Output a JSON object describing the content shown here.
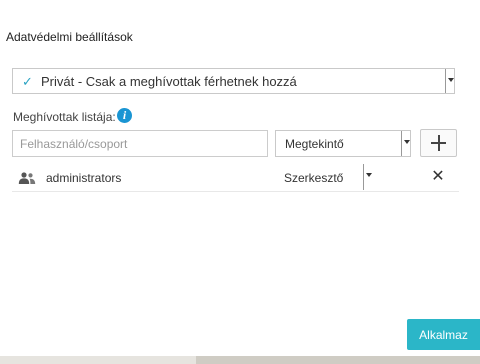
{
  "dialog": {
    "title": "Adatvédelmi beállítások",
    "visibility": {
      "icon": "check-icon",
      "selected": "Privát - Csak a meghívottak férhetnek hozzá"
    },
    "invites": {
      "label": "Meghívottak listája:",
      "info_icon": "info-icon",
      "info_glyph": "i",
      "user_placeholder": "Felhasználó/csoport",
      "permission_selected": "Megtekintő",
      "add_icon": "plus-icon"
    },
    "members": [
      {
        "icon": "users-icon",
        "name": "administrators",
        "permission": "Szerkesztő",
        "remove_icon": "close-icon",
        "remove_glyph": "✕"
      }
    ],
    "apply_label": "Alkalmaz"
  },
  "colors": {
    "accent": "#2bb6c8",
    "info": "#1a95d3",
    "check": "#2aa3c3"
  }
}
